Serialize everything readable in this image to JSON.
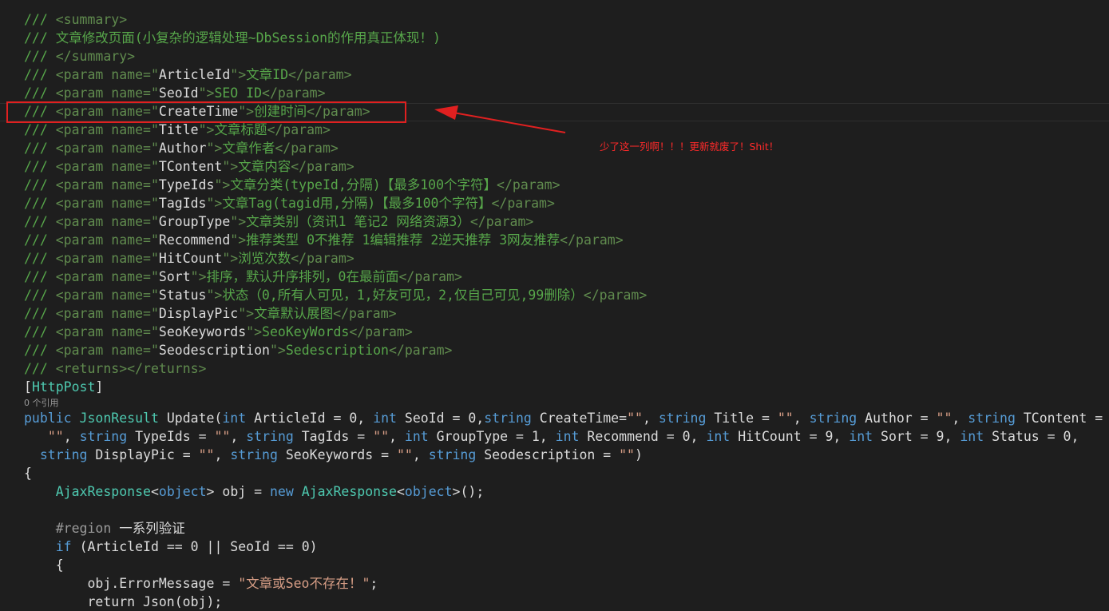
{
  "codelens": "0 个引用",
  "annotation": "少了这一列啊！！！更新就废了！Shit！",
  "colors": {
    "background": "#1e1e1e",
    "comment": "#57a64a",
    "doc_tag": "#608b4e",
    "keyword": "#569cd6",
    "type": "#4ec9b0",
    "string": "#d69d85",
    "plain": "#dcdcdc",
    "annotation_red": "#e02020"
  },
  "lines": [
    [
      [
        "/// ",
        "g"
      ],
      [
        "<summary>",
        "t"
      ]
    ],
    [
      [
        "/// ",
        "g"
      ],
      [
        "文章修改页面(小复杂的逻辑处理~DbSession的作用真正体现！)",
        "c"
      ]
    ],
    [
      [
        "/// ",
        "g"
      ],
      [
        "</summary>",
        "t"
      ]
    ],
    [
      [
        "/// ",
        "g"
      ],
      [
        "<param name=\"",
        "t"
      ],
      [
        "ArticleId",
        "p"
      ],
      [
        "\">",
        "t"
      ],
      [
        "文章ID",
        "c"
      ],
      [
        "</param>",
        "t"
      ]
    ],
    [
      [
        "/// ",
        "g"
      ],
      [
        "<param name=\"",
        "t"
      ],
      [
        "SeoId",
        "p"
      ],
      [
        "\">",
        "t"
      ],
      [
        "SEO ID",
        "c"
      ],
      [
        "</param>",
        "t"
      ]
    ],
    [
      [
        "/// ",
        "g"
      ],
      [
        "<param name=\"",
        "t"
      ],
      [
        "CreateTime",
        "p"
      ],
      [
        "\">",
        "t"
      ],
      [
        "创建时间",
        "c"
      ],
      [
        "</param>",
        "t"
      ]
    ],
    [
      [
        "/// ",
        "g"
      ],
      [
        "<param name=\"",
        "t"
      ],
      [
        "Title",
        "p"
      ],
      [
        "\">",
        "t"
      ],
      [
        "文章标题",
        "c"
      ],
      [
        "</param>",
        "t"
      ]
    ],
    [
      [
        "/// ",
        "g"
      ],
      [
        "<param name=\"",
        "t"
      ],
      [
        "Author",
        "p"
      ],
      [
        "\">",
        "t"
      ],
      [
        "文章作者",
        "c"
      ],
      [
        "</param>",
        "t"
      ]
    ],
    [
      [
        "/// ",
        "g"
      ],
      [
        "<param name=\"",
        "t"
      ],
      [
        "TContent",
        "p"
      ],
      [
        "\">",
        "t"
      ],
      [
        "文章内容",
        "c"
      ],
      [
        "</param>",
        "t"
      ]
    ],
    [
      [
        "/// ",
        "g"
      ],
      [
        "<param name=\"",
        "t"
      ],
      [
        "TypeIds",
        "p"
      ],
      [
        "\">",
        "t"
      ],
      [
        "文章分类(typeId,分隔)【最多100个字符】",
        "c"
      ],
      [
        "</param>",
        "t"
      ]
    ],
    [
      [
        "/// ",
        "g"
      ],
      [
        "<param name=\"",
        "t"
      ],
      [
        "TagIds",
        "p"
      ],
      [
        "\">",
        "t"
      ],
      [
        "文章Tag(tagid用,分隔)【最多100个字符】",
        "c"
      ],
      [
        "</param>",
        "t"
      ]
    ],
    [
      [
        "/// ",
        "g"
      ],
      [
        "<param name=\"",
        "t"
      ],
      [
        "GroupType",
        "p"
      ],
      [
        "\">",
        "t"
      ],
      [
        "文章类别（资讯1 笔记2 网络资源3）",
        "c"
      ],
      [
        "</param>",
        "t"
      ]
    ],
    [
      [
        "/// ",
        "g"
      ],
      [
        "<param name=\"",
        "t"
      ],
      [
        "Recommend",
        "p"
      ],
      [
        "\">",
        "t"
      ],
      [
        "推荐类型 0不推荐 1编辑推荐 2逆天推荐 3网友推荐",
        "c"
      ],
      [
        "</param>",
        "t"
      ]
    ],
    [
      [
        "/// ",
        "g"
      ],
      [
        "<param name=\"",
        "t"
      ],
      [
        "HitCount",
        "p"
      ],
      [
        "\">",
        "t"
      ],
      [
        "浏览次数",
        "c"
      ],
      [
        "</param>",
        "t"
      ]
    ],
    [
      [
        "/// ",
        "g"
      ],
      [
        "<param name=\"",
        "t"
      ],
      [
        "Sort",
        "p"
      ],
      [
        "\">",
        "t"
      ],
      [
        "排序，默认升序排列，0在最前面",
        "c"
      ],
      [
        "</param>",
        "t"
      ]
    ],
    [
      [
        "/// ",
        "g"
      ],
      [
        "<param name=\"",
        "t"
      ],
      [
        "Status",
        "p"
      ],
      [
        "\">",
        "t"
      ],
      [
        "状态（0,所有人可见，1,好友可见，2,仅自己可见,99删除）",
        "c"
      ],
      [
        "</param>",
        "t"
      ]
    ],
    [
      [
        "/// ",
        "g"
      ],
      [
        "<param name=\"",
        "t"
      ],
      [
        "DisplayPic",
        "p"
      ],
      [
        "\">",
        "t"
      ],
      [
        "文章默认展图",
        "c"
      ],
      [
        "</param>",
        "t"
      ]
    ],
    [
      [
        "/// ",
        "g"
      ],
      [
        "<param name=\"",
        "t"
      ],
      [
        "SeoKeywords",
        "p"
      ],
      [
        "\">",
        "t"
      ],
      [
        "SeoKeyWords",
        "c"
      ],
      [
        "</param>",
        "t"
      ]
    ],
    [
      [
        "/// ",
        "g"
      ],
      [
        "<param name=\"",
        "t"
      ],
      [
        "Seodescription",
        "p"
      ],
      [
        "\">",
        "t"
      ],
      [
        "Sedescription",
        "c"
      ],
      [
        "</param>",
        "t"
      ]
    ],
    [
      [
        "/// ",
        "g"
      ],
      [
        "<returns></returns>",
        "t"
      ]
    ],
    [
      [
        "[",
        "p"
      ],
      [
        "HttpPost",
        "y"
      ],
      [
        "]",
        "p"
      ]
    ],
    [
      [
        "public ",
        "k"
      ],
      [
        "JsonResult ",
        "y"
      ],
      [
        "Update(",
        "p"
      ],
      [
        "int ",
        "k"
      ],
      [
        "ArticleId = 0, ",
        "p"
      ],
      [
        "int ",
        "k"
      ],
      [
        "SeoId = 0,",
        "p"
      ],
      [
        "string ",
        "k"
      ],
      [
        "CreateTime=",
        "p"
      ],
      [
        "\"\"",
        "s"
      ],
      [
        ", ",
        "p"
      ],
      [
        "string ",
        "k"
      ],
      [
        "Title = ",
        "p"
      ],
      [
        "\"\"",
        "s"
      ],
      [
        ", ",
        "p"
      ],
      [
        "string ",
        "k"
      ],
      [
        "Author = ",
        "p"
      ],
      [
        "\"\"",
        "s"
      ],
      [
        ", ",
        "p"
      ],
      [
        "string ",
        "k"
      ],
      [
        "TContent =",
        "p"
      ]
    ],
    [
      [
        "   ",
        "p"
      ],
      [
        "\"\"",
        "s"
      ],
      [
        ", ",
        "p"
      ],
      [
        "string ",
        "k"
      ],
      [
        "TypeIds = ",
        "p"
      ],
      [
        "\"\"",
        "s"
      ],
      [
        ", ",
        "p"
      ],
      [
        "string ",
        "k"
      ],
      [
        "TagIds = ",
        "p"
      ],
      [
        "\"\"",
        "s"
      ],
      [
        ", ",
        "p"
      ],
      [
        "int ",
        "k"
      ],
      [
        "GroupType = 1, ",
        "p"
      ],
      [
        "int ",
        "k"
      ],
      [
        "Recommend = 0, ",
        "p"
      ],
      [
        "int ",
        "k"
      ],
      [
        "HitCount = 9, ",
        "p"
      ],
      [
        "int ",
        "k"
      ],
      [
        "Sort = 9, ",
        "p"
      ],
      [
        "int ",
        "k"
      ],
      [
        "Status = 0,",
        "p"
      ]
    ],
    [
      [
        "  ",
        "p"
      ],
      [
        "string ",
        "k"
      ],
      [
        "DisplayPic = ",
        "p"
      ],
      [
        "\"\"",
        "s"
      ],
      [
        ", ",
        "p"
      ],
      [
        "string ",
        "k"
      ],
      [
        "SeoKeywords = ",
        "p"
      ],
      [
        "\"\"",
        "s"
      ],
      [
        ", ",
        "p"
      ],
      [
        "string ",
        "k"
      ],
      [
        "Seodescription = ",
        "p"
      ],
      [
        "\"\"",
        "s"
      ],
      [
        ")",
        "p"
      ]
    ],
    [
      [
        "{",
        "p"
      ]
    ],
    [
      [
        "    ",
        "p"
      ],
      [
        "AjaxResponse",
        "y"
      ],
      [
        "<",
        "p"
      ],
      [
        "object",
        "k"
      ],
      [
        "> obj = ",
        "p"
      ],
      [
        "new ",
        "k"
      ],
      [
        "AjaxResponse",
        "y"
      ],
      [
        "<",
        "p"
      ],
      [
        "object",
        "k"
      ],
      [
        ">();",
        "p"
      ]
    ],
    [
      [
        "",
        "p"
      ]
    ],
    [
      [
        "    ",
        "p"
      ],
      [
        "#region ",
        "r"
      ],
      [
        "一系列验证",
        "p"
      ]
    ],
    [
      [
        "    ",
        "p"
      ],
      [
        "if ",
        "k"
      ],
      [
        "(ArticleId == 0 || SeoId == 0)",
        "p"
      ]
    ],
    [
      [
        "    {",
        "p"
      ]
    ],
    [
      [
        "        obj.ErrorMessage = ",
        "p"
      ],
      [
        "\"文章或Seo不存在！\"",
        "s"
      ],
      [
        ";",
        "p"
      ]
    ],
    [
      [
        "        return Json(obj);",
        "p"
      ]
    ]
  ]
}
